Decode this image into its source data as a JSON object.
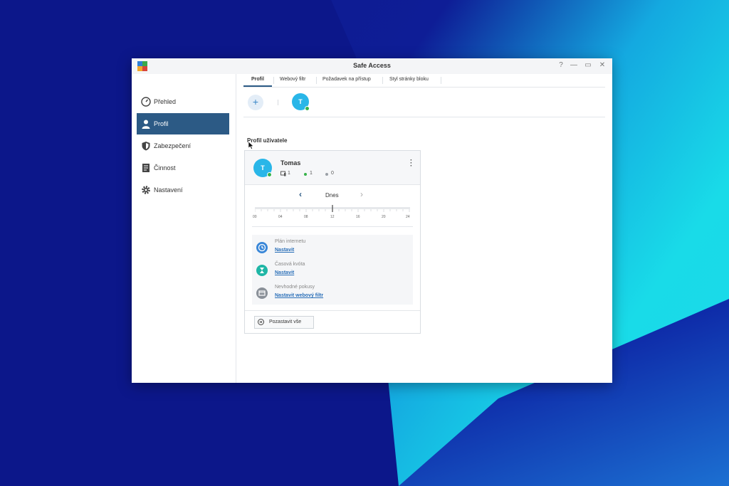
{
  "window": {
    "title": "Safe Access",
    "controls": [
      "?",
      "—",
      "▭",
      "✕"
    ]
  },
  "sidebar": {
    "items": [
      {
        "label": "Přehled",
        "icon": "dashboard-icon",
        "active": false
      },
      {
        "label": "Profil",
        "icon": "user-icon",
        "active": true
      },
      {
        "label": "Zabezpečení",
        "icon": "shield-icon",
        "active": false
      },
      {
        "label": "Činnost",
        "icon": "activity-log-icon",
        "active": false
      },
      {
        "label": "Nastavení",
        "icon": "gear-icon",
        "active": false
      }
    ]
  },
  "tabs": [
    {
      "label": "Profil",
      "active": true
    },
    {
      "label": "Webový filtr",
      "active": false
    },
    {
      "label": "Požadavek na přístup",
      "active": false
    },
    {
      "label": "Styl stránky bloku",
      "active": false
    }
  ],
  "avatar_bar": {
    "add_label": "+",
    "profiles": [
      {
        "initial": "T",
        "online": true
      }
    ]
  },
  "section_title": "Profil uživatele",
  "profile_card": {
    "initial": "T",
    "name": "Tomas",
    "devices": "1",
    "online": "1",
    "offline": "0",
    "day_label": "Dnes",
    "prev": "‹",
    "next": "›",
    "timeline_ticks": [
      "00",
      "04",
      "08",
      "12",
      "16",
      "20",
      "24"
    ],
    "rules": [
      {
        "label": "Plán internetu",
        "link": "Nastavit",
        "icon": "clock-icon",
        "color": "#3a87d8"
      },
      {
        "label": "Časová kvóta",
        "link": "Nastavit",
        "icon": "hourglass-icon",
        "color": "#1fb6a6"
      },
      {
        "label": "Nevhodné pokusy",
        "link": "Nastavit webový filtr",
        "icon": "blocked-page-icon",
        "color": "#8a9098"
      }
    ],
    "pause_label": "Pozastavit vše"
  },
  "colors": {
    "accent": "#2c5a85",
    "avatar": "#29b6e8",
    "online": "#36b24a",
    "link": "#2a6fb8"
  }
}
